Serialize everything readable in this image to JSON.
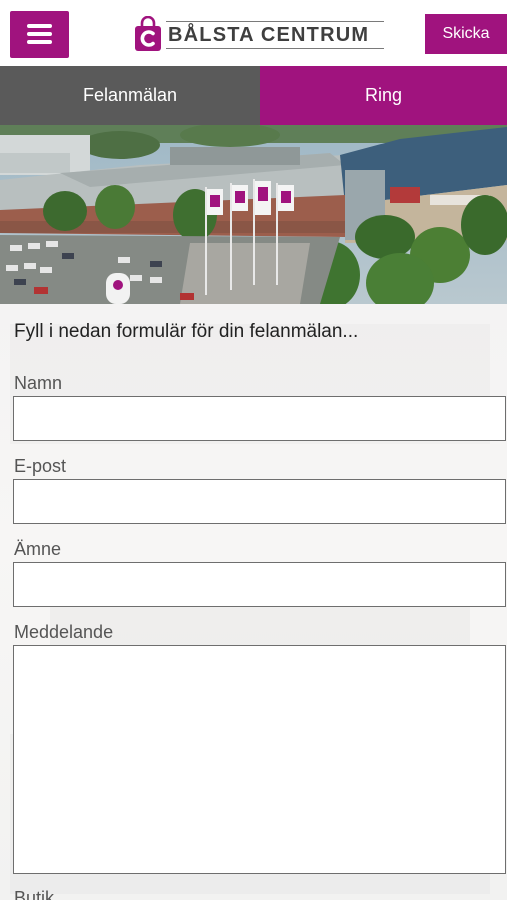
{
  "header": {
    "menu_icon": "hamburger-menu-icon",
    "logo_text": "BÅLSTA CENTRUM",
    "logo_icon": "shopping-bag-c-icon",
    "send_label": "Skicka",
    "brand_color": "#a0137e"
  },
  "tabs": [
    {
      "label": "Felanmälan",
      "active": true,
      "color": "#5a5a5a"
    },
    {
      "label": "Ring",
      "active": false,
      "color": "#a0137e"
    }
  ],
  "hero": {
    "image": "aerial-photo-shopping-centre"
  },
  "form": {
    "intro": "Fyll i nedan formulär för din felanmälan...",
    "fields": [
      {
        "label": "Namn",
        "value": "",
        "type": "text"
      },
      {
        "label": "E-post",
        "value": "",
        "type": "email"
      },
      {
        "label": "Ämne",
        "value": "",
        "type": "text"
      },
      {
        "label": "Meddelande",
        "value": "",
        "type": "textarea"
      },
      {
        "label": "Butik",
        "value": "",
        "type": "select"
      }
    ]
  }
}
